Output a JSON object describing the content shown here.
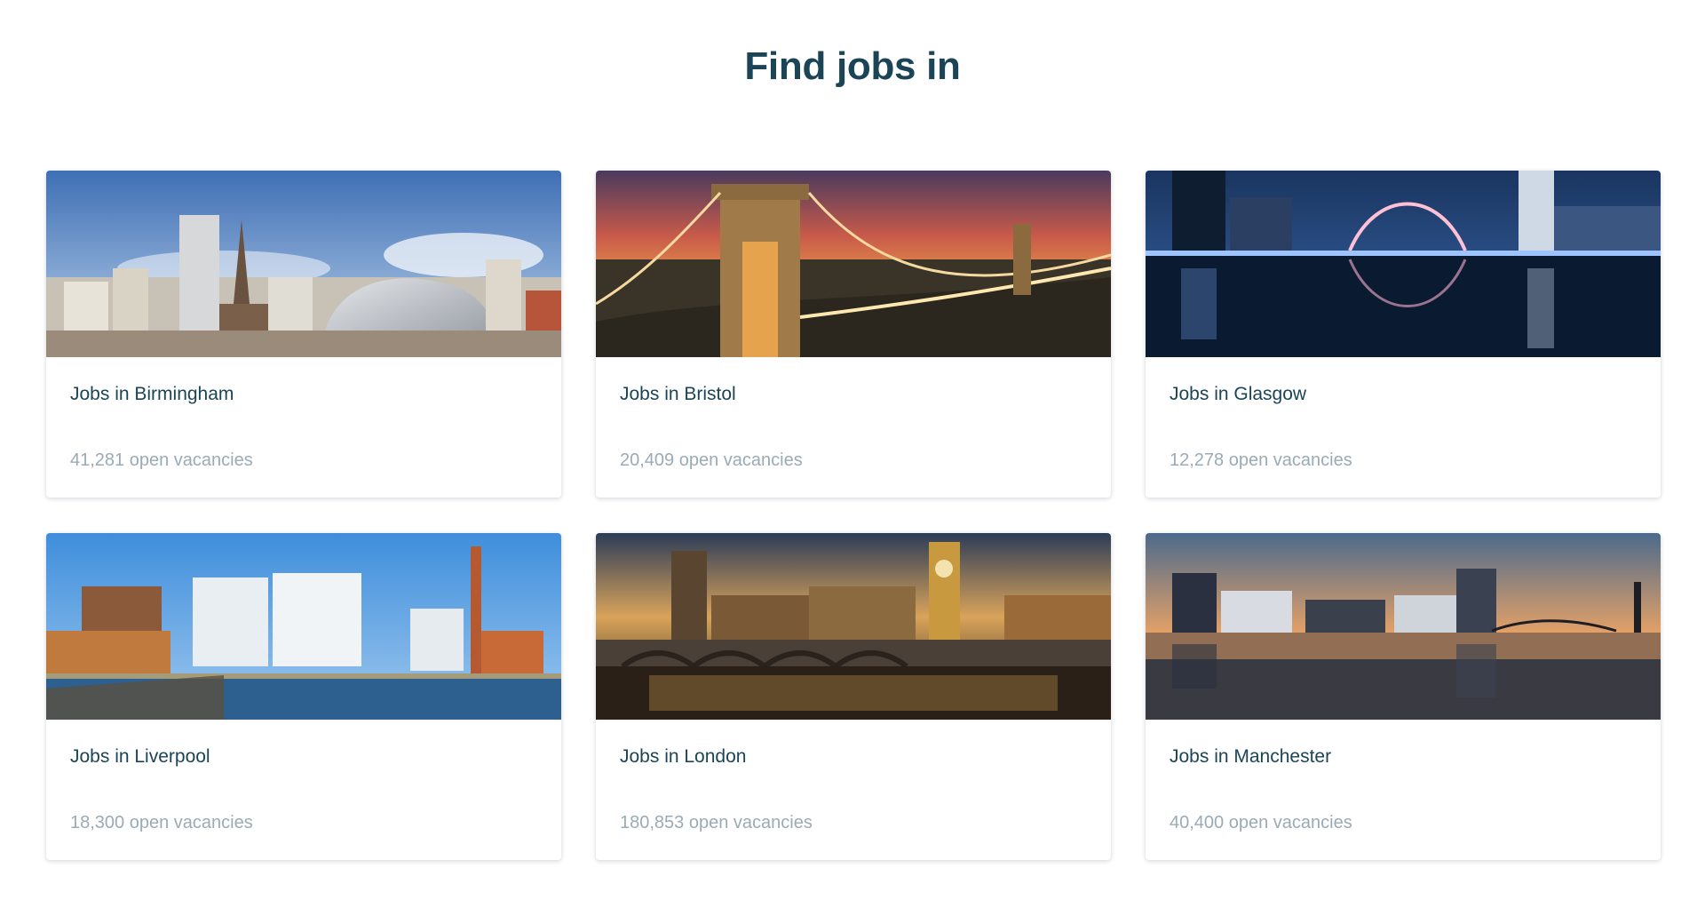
{
  "header": {
    "title": "Find jobs in"
  },
  "cities": [
    {
      "title": "Jobs in Birmingham",
      "count": "41,281 open vacancies",
      "image": "birmingham-skyline-photo"
    },
    {
      "title": "Jobs in Bristol",
      "count": "20,409 open vacancies",
      "image": "bristol-suspension-bridge-photo"
    },
    {
      "title": "Jobs in Glasgow",
      "count": "12,278 open vacancies",
      "image": "glasgow-arch-bridge-night-photo"
    },
    {
      "title": "Jobs in Liverpool",
      "count": "18,300 open vacancies",
      "image": "liverpool-docks-photo"
    },
    {
      "title": "Jobs in London",
      "count": "180,853 open vacancies",
      "image": "london-westminster-photo"
    },
    {
      "title": "Jobs in Manchester",
      "count": "40,400 open vacancies",
      "image": "manchester-salford-quays-photo"
    }
  ],
  "colors": {
    "title": "#1b4457",
    "muted": "#9aabb6"
  }
}
